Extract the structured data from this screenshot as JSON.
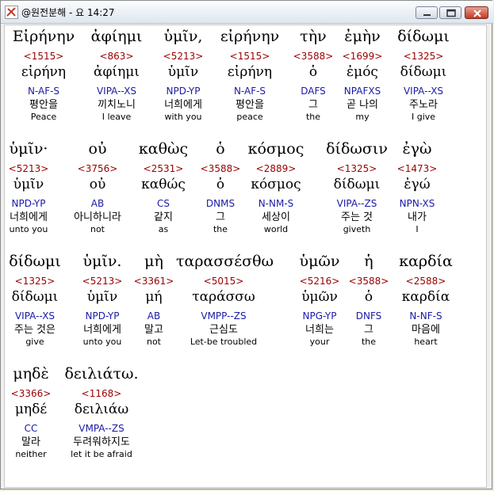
{
  "window": {
    "title": "@원전분해 - 요 14:27",
    "buttons": {
      "minimize": "minimize-icon",
      "maximize": "maximize-icon",
      "close": "close-icon"
    }
  },
  "words": [
    {
      "g": "Εἰρήνην",
      "s": "<1515>",
      "l": "εἰρήνη",
      "p": "N-AF-S",
      "k": "평안을",
      "e": "Peace"
    },
    {
      "g": "ἀφίημι",
      "s": "<863>",
      "l": "ἀφίημι",
      "p": "VIPA--XS",
      "k": "끼치노니",
      "e": "I leave"
    },
    {
      "g": "ὑμῖν,",
      "s": "<5213>",
      "l": "ὑμῖν",
      "p": "NPD-YP",
      "k": "너희에게",
      "e": "with you"
    },
    {
      "g": "εἰρήνην",
      "s": "<1515>",
      "l": "εἰρήνη",
      "p": "N-AF-S",
      "k": "평안을",
      "e": "peace"
    },
    {
      "g": "τὴν",
      "s": "<3588>",
      "l": "ὁ",
      "p": "DAFS",
      "k": "그",
      "e": "the"
    },
    {
      "g": "ἐμὴν",
      "s": "<1699>",
      "l": "ἐμός",
      "p": "NPAFXS",
      "k": "곧 나의",
      "e": "my"
    },
    {
      "g": "δίδωμι",
      "s": "<1325>",
      "l": "δίδωμι",
      "p": "VIPA--XS",
      "k": "주노라",
      "e": "I give"
    },
    {
      "g": "ὑμῖν·",
      "s": "<5213>",
      "l": "ὑμῖν",
      "p": "NPD-YP",
      "k": "너희에게",
      "e": "unto you"
    },
    {
      "g": "οὐ",
      "s": "<3756>",
      "l": "οὐ",
      "p": "AB",
      "k": "아니하니라",
      "e": "not"
    },
    {
      "g": "καθὼς",
      "s": "<2531>",
      "l": "καθώς",
      "p": "CS",
      "k": "같지",
      "e": "as"
    },
    {
      "g": "ὁ",
      "s": "<3588>",
      "l": "ὁ",
      "p": "DNMS",
      "k": "그",
      "e": "the"
    },
    {
      "g": "κόσμος",
      "s": "<2889>",
      "l": "κόσμος",
      "p": "N-NM-S",
      "k": "세상이",
      "e": "world"
    },
    {
      "g": "δίδωσιν",
      "s": "<1325>",
      "l": "δίδωμι",
      "p": "VIPA--ZS",
      "k": "주는 것",
      "e": "giveth"
    },
    {
      "g": "ἐγὼ",
      "s": "<1473>",
      "l": "ἐγώ",
      "p": "NPN-XS",
      "k": "내가",
      "e": "I"
    },
    {
      "g": "δίδωμι",
      "s": "<1325>",
      "l": "δίδωμι",
      "p": "VIPA--XS",
      "k": "주는 것은",
      "e": "give"
    },
    {
      "g": "ὑμῖν.",
      "s": "<5213>",
      "l": "ὑμῖν",
      "p": "NPD-YP",
      "k": "너희에게",
      "e": "unto you"
    },
    {
      "g": "μὴ",
      "s": "<3361>",
      "l": "μή",
      "p": "AB",
      "k": "말고",
      "e": "not"
    },
    {
      "g": "ταρασσέσθω",
      "s": "<5015>",
      "l": "ταράσσω",
      "p": "VMPP--ZS",
      "k": "근심도",
      "e": "Let-be troubled"
    },
    {
      "g": "ὑμῶν",
      "s": "<5216>",
      "l": "ὑμῶν",
      "p": "NPG-YP",
      "k": "너희는",
      "e": "your"
    },
    {
      "g": "ἡ",
      "s": "<3588>",
      "l": "ὁ",
      "p": "DNFS",
      "k": "그",
      "e": "the"
    },
    {
      "g": "καρδία",
      "s": "<2588>",
      "l": "καρδία",
      "p": "N-NF-S",
      "k": "마음에",
      "e": "heart"
    },
    {
      "g": "μηδὲ",
      "s": "<3366>",
      "l": "μηδέ",
      "p": "CC",
      "k": "말라",
      "e": "neither"
    },
    {
      "g": "δειλιάτω.",
      "s": "<1168>",
      "l": "δειλιάω",
      "p": "VMPA--ZS",
      "k": "두려워하지도",
      "e": "let it be afraid"
    }
  ]
}
